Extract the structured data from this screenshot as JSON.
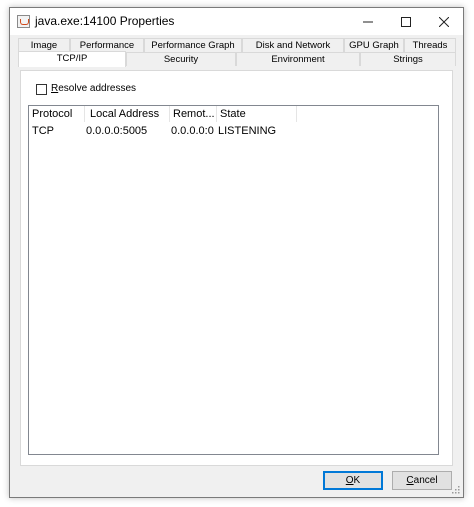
{
  "window": {
    "title": "java.exe:14100 Properties",
    "app_icon": "java-cup-icon"
  },
  "tabs": {
    "row1": [
      "Image",
      "Performance",
      "Performance Graph",
      "Disk and Network",
      "GPU Graph",
      "Threads"
    ],
    "row2": [
      "TCP/IP",
      "Security",
      "Environment",
      "Strings"
    ],
    "active": "TCP/IP"
  },
  "options": {
    "resolve_label_prefix": "R",
    "resolve_label_rest": "esolve addresses",
    "resolve_checked": false
  },
  "table": {
    "columns": [
      "Protocol",
      "Local Address",
      "Remot...",
      "State"
    ],
    "rows": [
      [
        "TCP",
        "0.0.0.0:5005",
        "0.0.0.0:0",
        "LISTENING"
      ]
    ]
  },
  "buttons": {
    "ok_prefix": "",
    "ok_underline": "O",
    "ok_rest": "K",
    "cancel_prefix": "",
    "cancel_underline": "C",
    "cancel_rest": "ancel"
  },
  "colors": {
    "accent": "#0078d7",
    "window_bg": "#f0f0f0"
  }
}
